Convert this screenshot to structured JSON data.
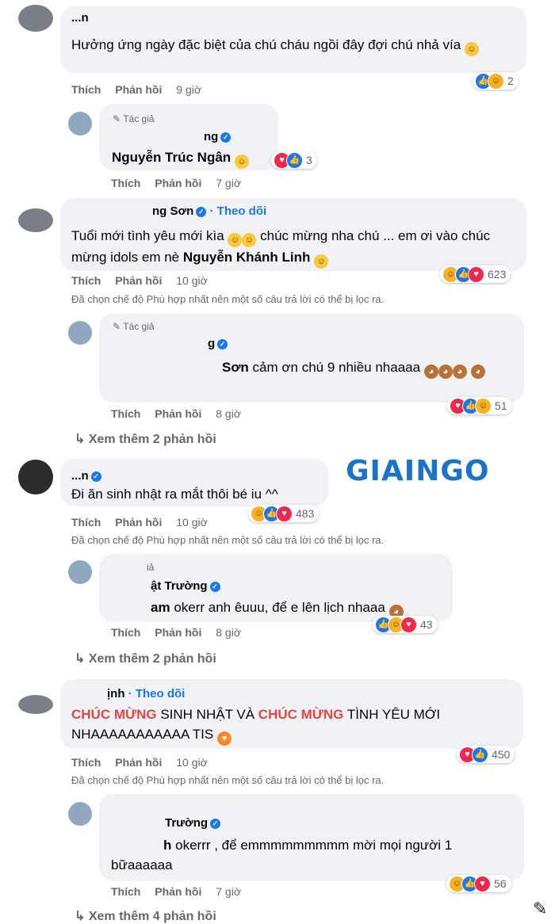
{
  "brand": {
    "logo_text": "GIAINGO"
  },
  "comments": [
    {
      "name": "...n",
      "text": "Hưởng ứng ngày đặc biệt của chú cháu ngồi đây đợi chú nhả vía",
      "actions": {
        "like": "Thích",
        "reply": "Phản hồi",
        "time": "9 giờ"
      },
      "reactions": {
        "count": "2"
      },
      "replies": [
        {
          "author_tag": "Tác giả",
          "name": "ng",
          "mention": "Nguyễn Trúc Ngân",
          "text": "",
          "actions": {
            "like": "Thích",
            "reply": "Phản hồi",
            "time": "7 giờ"
          },
          "reactions": {
            "count": "3"
          }
        }
      ]
    },
    {
      "name": "ng Sơn",
      "follow": "· Theo dõi",
      "text_a": "Tuổi mới tình yêu mới kìa",
      "text_b": "chúc mừng nha chú ... em ơi vào chúc mừng idols em nè",
      "mention": "Nguyễn Khánh Linh",
      "actions": {
        "like": "Thích",
        "reply": "Phản hồi",
        "time": "10 giờ"
      },
      "reactions": {
        "count": "623"
      },
      "filter_note": "Đã chọn chế độ Phù hợp nhất nên một số câu trả lời có thể bị lọc ra.",
      "replies": [
        {
          "author_tag": "Tác giả",
          "name": "g",
          "mention": "Sơn",
          "text": "cảm ơn chú 9 nhiều nhaaaa",
          "actions": {
            "like": "Thích",
            "reply": "Phản hồi",
            "time": "8 giờ"
          },
          "reactions": {
            "count": "51"
          }
        }
      ],
      "see_more": "Xem thêm 2 phản hồi"
    },
    {
      "name": "...n",
      "text": "Đi ăn sinh nhật ra mắt thôi bé iu ^^",
      "actions": {
        "like": "Thích",
        "reply": "Phản hồi",
        "time": "10 giờ"
      },
      "reactions": {
        "count": "483"
      },
      "filter_note": "Đã chọn chế độ Phù hợp nhất nên một số câu trả lời có thể bị lọc ra.",
      "replies": [
        {
          "author_tag": "iả",
          "name": "ật Trường",
          "mention": "am",
          "text": "okerr anh êuuu, để e lên lịch nhaaa",
          "actions": {
            "like": "Thích",
            "reply": "Phản hồi",
            "time": "8 giờ"
          },
          "reactions": {
            "count": "43"
          }
        }
      ],
      "see_more": "Xem thêm 2 phản hồi"
    },
    {
      "name": "ịnh",
      "follow": "· Theo dõi",
      "text_parts": [
        "CHÚC MỪNG",
        "SINH NHẬT VÀ",
        "CHÚC MỪNG",
        "TÌNH YÊU MỚI NHAAAAAAAAAAA TIS"
      ],
      "actions": {
        "like": "Thích",
        "reply": "Phản hồi",
        "time": "10 giờ"
      },
      "reactions": {
        "count": "450"
      },
      "filter_note": "Đã chọn chế độ Phù hợp nhất nên một số câu trả lời có thể bị lọc ra.",
      "replies": [
        {
          "name": "Trường",
          "mention": "h",
          "text": "okerrr , để emmmmmmmmm mời mọi người 1 bữaaaaaa",
          "actions": {
            "like": "Thích",
            "reply": "Phản hồi",
            "time": "7 giờ"
          },
          "reactions": {
            "count": "56"
          }
        }
      ],
      "see_more": "Xem thêm 4 phản hồi"
    }
  ]
}
